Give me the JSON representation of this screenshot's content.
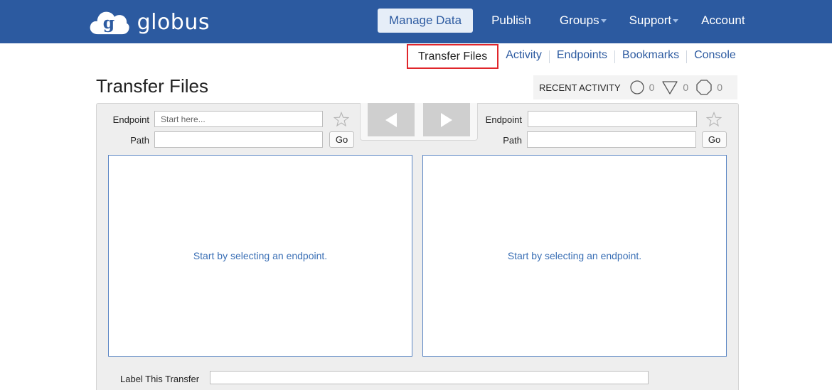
{
  "app": {
    "logo_text": "globus",
    "logo_letter": "g"
  },
  "main_nav": {
    "items": [
      {
        "label": "Manage Data",
        "active": true,
        "has_caret": false
      },
      {
        "label": "Publish",
        "active": false,
        "has_caret": false
      },
      {
        "label": "Groups",
        "active": false,
        "has_caret": true
      },
      {
        "label": "Support",
        "active": false,
        "has_caret": true
      },
      {
        "label": "Account",
        "active": false,
        "has_caret": false
      }
    ]
  },
  "sub_nav": {
    "items": [
      {
        "label": "Transfer Files",
        "current": true
      },
      {
        "label": "Activity",
        "current": false
      },
      {
        "label": "Endpoints",
        "current": false
      },
      {
        "label": "Bookmarks",
        "current": false
      },
      {
        "label": "Console",
        "current": false
      }
    ]
  },
  "page": {
    "title": "Transfer Files"
  },
  "recent_activity": {
    "label": "RECENT ACTIVITY",
    "active_count": "0",
    "warning_count": "0",
    "failed_count": "0"
  },
  "transfer": {
    "left": {
      "endpoint_label": "Endpoint",
      "endpoint_value": "",
      "endpoint_placeholder": "Start here...",
      "path_label": "Path",
      "path_value": "",
      "go_label": "Go",
      "empty_hint": "Start by selecting an endpoint."
    },
    "right": {
      "endpoint_label": "Endpoint",
      "endpoint_value": "",
      "endpoint_placeholder": "",
      "path_label": "Path",
      "path_value": "",
      "go_label": "Go",
      "empty_hint": "Start by selecting an endpoint."
    },
    "label_transfer": "Label This Transfer"
  },
  "colors": {
    "brand_blue": "#2c5aa0",
    "highlight_red": "#e0262b",
    "link_blue": "#3a6fb5"
  }
}
